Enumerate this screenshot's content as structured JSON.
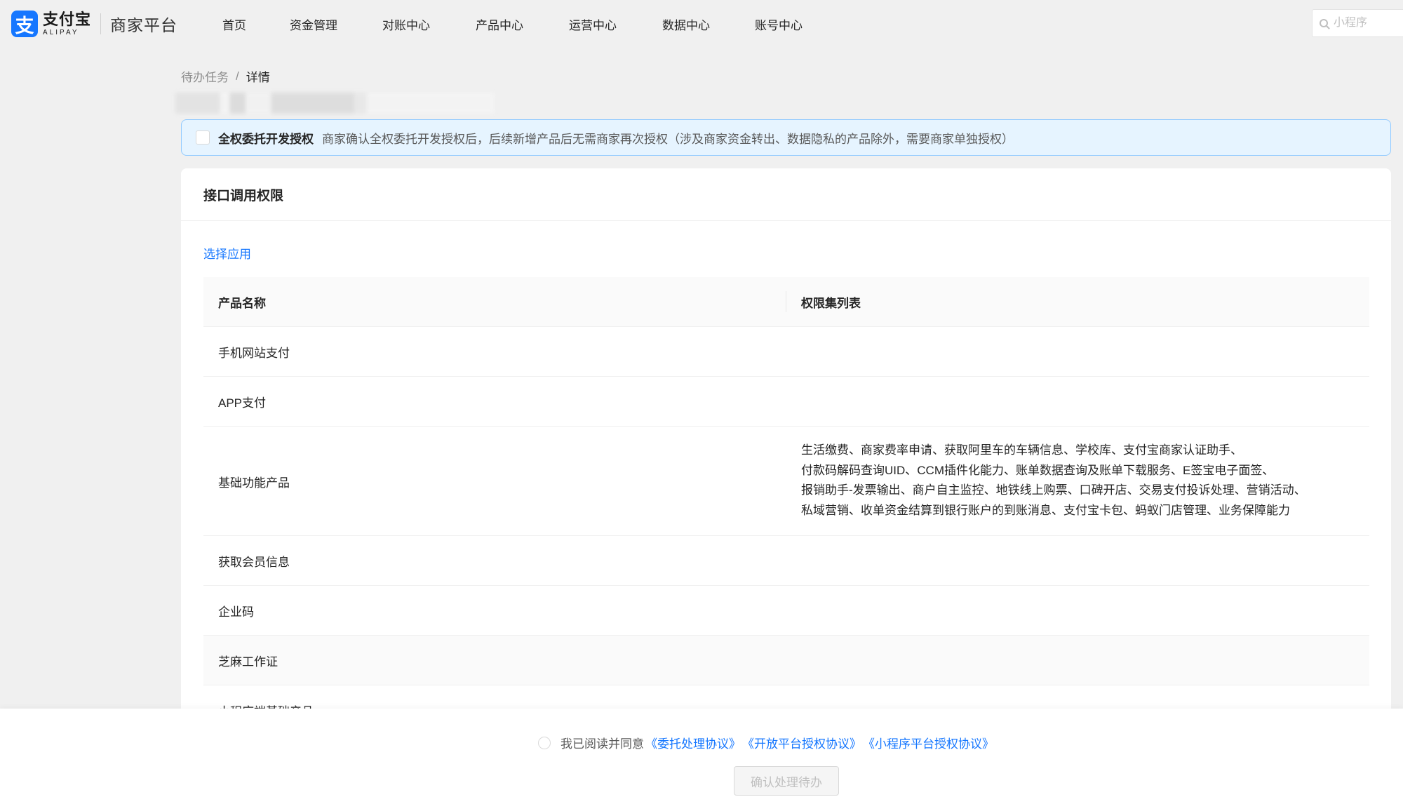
{
  "header": {
    "logo_cn": "支付宝",
    "logo_en": "ALIPAY",
    "platform": "商家平台",
    "nav": [
      "首页",
      "资金管理",
      "对账中心",
      "产品中心",
      "运营中心",
      "数据中心",
      "账号中心"
    ],
    "search_placeholder": "小程序"
  },
  "breadcrumb": {
    "parent": "待办任务",
    "separator": "/",
    "current": "详情"
  },
  "alert": {
    "title": "全权委托开发授权",
    "desc": "商家确认全权委托开发授权后，后续新增产品后无需商家再次授权（涉及商家资金转出、数据隐私的产品除外，需要商家单独授权）"
  },
  "card": {
    "title": "接口调用权限",
    "select_app": "选择应用",
    "columns": [
      "产品名称",
      "权限集列表"
    ],
    "rows": [
      {
        "name": "手机网站支付",
        "perms": []
      },
      {
        "name": "APP支付",
        "perms": []
      },
      {
        "name": "基础功能产品",
        "perms": [
          "生活缴费、商家费率申请、获取阿里车的车辆信息、学校库、支付宝商家认证助手、",
          "付款码解码查询UID、CCM插件化能力、账单数据查询及账单下载服务、E签宝电子面签、",
          "报销助手-发票输出、商户自主监控、地铁线上购票、口碑开店、交易支付投诉处理、营销活动、",
          "私域营销、收单资金结算到银行账户的到账消息、支付宝卡包、蚂蚁门店管理、业务保障能力"
        ]
      },
      {
        "name": "获取会员信息",
        "perms": []
      },
      {
        "name": "企业码",
        "perms": []
      },
      {
        "name": "芝麻工作证",
        "perms": []
      },
      {
        "name": "小程序端基础产品",
        "perms": []
      }
    ]
  },
  "footer": {
    "agree_text": "我已阅读并同意",
    "links": [
      "《委托处理协议》",
      "《开放平台授权协议》",
      "《小程序平台授权协议》"
    ],
    "confirm": "确认处理待办"
  },
  "colors": {
    "accent": "#1677ff",
    "alert_bg": "#e6f4ff",
    "alert_border": "#91caff"
  }
}
